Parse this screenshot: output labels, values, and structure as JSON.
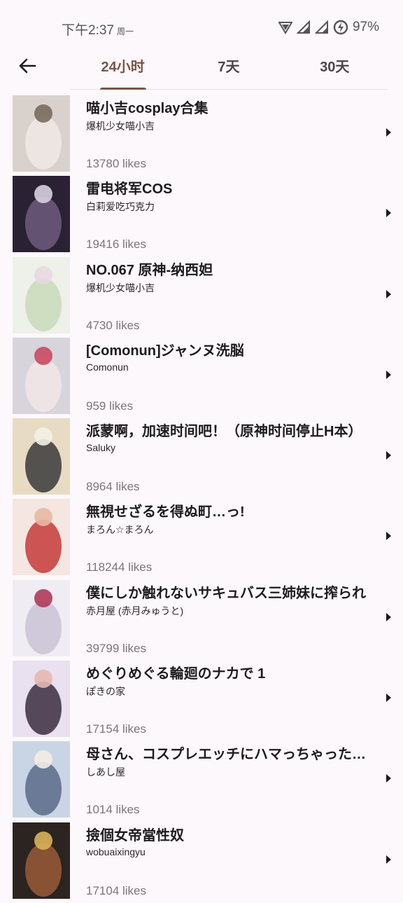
{
  "status_bar": {
    "time": "下午2:37",
    "weekday": "周一",
    "battery": "97%"
  },
  "tabs": [
    {
      "label": "24小时",
      "active": true
    },
    {
      "label": "7天",
      "active": false
    },
    {
      "label": "30天",
      "active": false
    }
  ],
  "items": [
    {
      "title": "喵小吉cosplay合集",
      "author": "爆机少女喵小吉",
      "likes": "13780 likes",
      "thumb_colors": [
        "#d9d2cc",
        "#efe9e4",
        "#7a6a5e"
      ]
    },
    {
      "title": "雷电将军COS",
      "author": "白莉爱吃巧克力",
      "likes": "19416 likes",
      "thumb_colors": [
        "#2a2233",
        "#6d5a7e",
        "#d8cfe0"
      ]
    },
    {
      "title": "NO.067 原神-纳西妲",
      "author": "爆机少女喵小吉",
      "likes": "4730 likes",
      "thumb_colors": [
        "#eef0ea",
        "#c9d9b8",
        "#e8d8e0"
      ]
    },
    {
      "title": "[Comonun]ジャンヌ洗脳",
      "author": "Comonun",
      "likes": "959 likes",
      "thumb_colors": [
        "#d8d4dc",
        "#f2e6e6",
        "#c94a62"
      ]
    },
    {
      "title": "派蒙啊，加速时间吧！（原神时间停止H本）",
      "author": "Saluky",
      "likes": "8964 likes",
      "thumb_colors": [
        "#e7dcc3",
        "#3a3a3a",
        "#f2efe6"
      ]
    },
    {
      "title": "無視せざるを得ぬ町…っ!",
      "author": "まろん☆まろん",
      "likes": "118244 likes",
      "thumb_colors": [
        "#f4e6e0",
        "#c43a3a",
        "#e9b7a4"
      ]
    },
    {
      "title": "僕にしか触れないサキュバス三姉妹に搾られ",
      "author": "赤月屋 (赤月みゅうと)",
      "likes": "39799 likes",
      "thumb_colors": [
        "#f0ecf3",
        "#c9c3d4",
        "#b03a5a"
      ]
    },
    {
      "title": "めぐりめぐる輪廻のナカで 1",
      "author": "ぽきの家",
      "likes": "17154 likes",
      "thumb_colors": [
        "#e9e1ef",
        "#3a2d3f",
        "#e7b8b0"
      ]
    },
    {
      "title": "母さん、コスプレエッチにハマっちゃった…",
      "author": "しあし屋",
      "likes": "1014 likes",
      "thumb_colors": [
        "#c9d5e4",
        "#5a6a88",
        "#f3ece6"
      ]
    },
    {
      "title": "撿個女帝當性奴",
      "author": "wobuaixingyu",
      "likes": "17104 likes",
      "thumb_colors": [
        "#2b2420",
        "#9a5a3a",
        "#d9b25a"
      ]
    }
  ]
}
